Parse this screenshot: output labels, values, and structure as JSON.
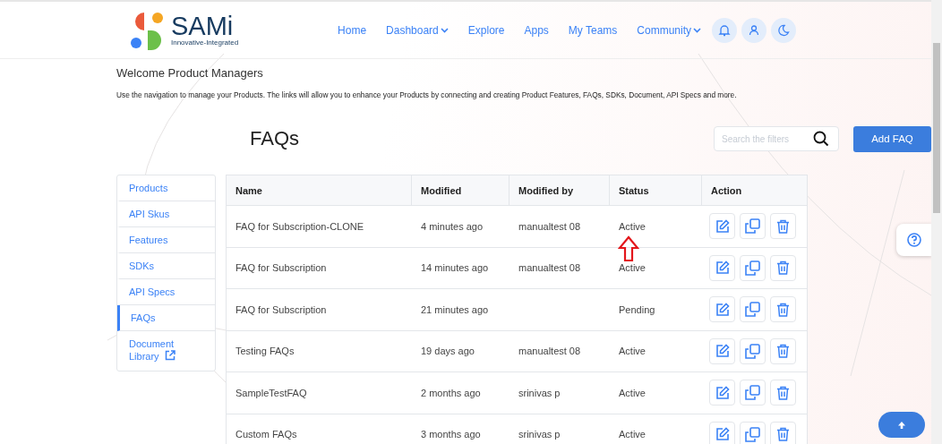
{
  "logo": {
    "name": "SAMi",
    "tagline": "Innovative-Integrated"
  },
  "nav": [
    {
      "label": "Home",
      "dropdown": false
    },
    {
      "label": "Dashboard",
      "dropdown": true
    },
    {
      "label": "Explore",
      "dropdown": false
    },
    {
      "label": "Apps",
      "dropdown": false
    },
    {
      "label": "My Teams",
      "dropdown": false
    },
    {
      "label": "Community",
      "dropdown": true
    }
  ],
  "welcome": {
    "title": "Welcome Product Managers",
    "text": "Use the navigation to manage your Products. The links will allow you to enhance your Products by connecting and creating Product Features, FAQs, SDKs, Document, API Specs and more."
  },
  "page_title": "FAQs",
  "search": {
    "placeholder": "Search the filters"
  },
  "add_button": "Add FAQ",
  "sidebar": [
    {
      "label": "Products",
      "selected": false,
      "external": false
    },
    {
      "label": "API Skus",
      "selected": false,
      "external": false
    },
    {
      "label": "Features",
      "selected": false,
      "external": false
    },
    {
      "label": "SDKs",
      "selected": false,
      "external": false
    },
    {
      "label": "API Specs",
      "selected": false,
      "external": false
    },
    {
      "label": "FAQs",
      "selected": true,
      "external": false
    },
    {
      "label": "Document Library",
      "selected": false,
      "external": true
    }
  ],
  "table": {
    "columns": [
      "Name",
      "Modified",
      "Modified by",
      "Status",
      "Action"
    ],
    "rows": [
      {
        "name": "FAQ for Subscription-CLONE",
        "modified": "4 minutes ago",
        "modified_by": "manualtest 08",
        "status": "Active"
      },
      {
        "name": "FAQ for Subscription",
        "modified": "14 minutes ago",
        "modified_by": "manualtest 08",
        "status": "Active"
      },
      {
        "name": "FAQ for Subscription",
        "modified": "21 minutes ago",
        "status": "Pending"
      },
      {
        "name": "Testing FAQs",
        "modified": "19 days ago",
        "modified_by": "manualtest 08",
        "status": "Active"
      },
      {
        "name": "SampleTestFAQ",
        "modified": "2 months ago",
        "modified_by": "srinivas p",
        "status": "Active"
      },
      {
        "name": "Custom FAQs",
        "modified": "3 months ago",
        "modified_by": "srinivas p",
        "status": "Active"
      }
    ]
  }
}
